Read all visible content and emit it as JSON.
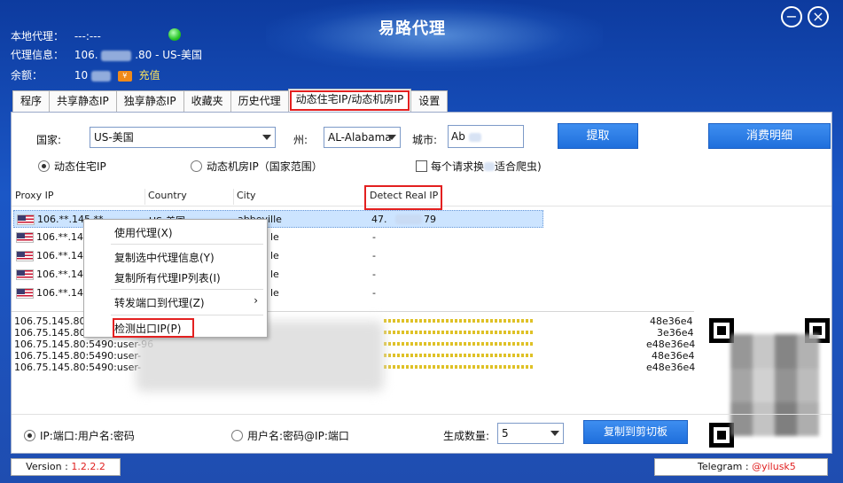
{
  "app": {
    "title": "易路代理",
    "minimize_glyph": "−",
    "close_glyph": "×"
  },
  "info": {
    "local_proxy_label": "本地代理：",
    "local_proxy_value": "---:---",
    "proxy_info_label": "代理信息：",
    "proxy_info_prefix": "106.",
    "proxy_info_suffix": ".80 - US-美国",
    "balance_label": "余额：",
    "balance_prefix": "10",
    "balance_badge": "¥",
    "recharge_label": "充值",
    "status_color": "#28c528"
  },
  "tabs": [
    {
      "label": "程序"
    },
    {
      "label": "共享静态IP"
    },
    {
      "label": "独享静态IP"
    },
    {
      "label": "收藏夹"
    },
    {
      "label": "历史代理"
    },
    {
      "label": "动态住宅IP/动态机房IP",
      "active": true
    },
    {
      "label": "设置"
    }
  ],
  "form": {
    "country_label": "国家:",
    "country_value": "US-美国",
    "state_label": "州:",
    "state_value": "AL-Alabama",
    "city_label": "城市:",
    "city_value": "Ab",
    "fetch_button": "提取",
    "billing_button": "消费明细",
    "radio_residential": "动态住宅IP",
    "radio_datacenter": "动态机房IP（国家范围）",
    "checkbox_per_request": "每个请求换",
    "checkbox_suffix": "适合爬虫)"
  },
  "table": {
    "headers": [
      "Proxy IP",
      "Country",
      "City",
      "Detect Real IP"
    ],
    "rows": [
      {
        "ip": "106.**.145.**",
        "country": "US-美国",
        "city": "abbeville",
        "real_ip": "47.",
        "real_ip_tail": "79"
      },
      {
        "ip": "106.**.145.",
        "country": "",
        "city": "le",
        "real_ip": "-",
        "real_ip_tail": ""
      },
      {
        "ip": "106.**.145.",
        "country": "",
        "city": "le",
        "real_ip": "-",
        "real_ip_tail": ""
      },
      {
        "ip": "106.**.145.",
        "country": "",
        "city": "le",
        "real_ip": "-",
        "real_ip_tail": ""
      },
      {
        "ip": "106.**.145.",
        "country": "",
        "city": "le",
        "real_ip": "-",
        "real_ip_tail": ""
      }
    ]
  },
  "context_menu": {
    "items": [
      "使用代理(X)",
      "复制选中代理信息(Y)",
      "复制所有代理IP列表(I)",
      "转发端口到代理(Z)",
      "检测出口IP(P)"
    ],
    "submenu_glyph": "›"
  },
  "output": {
    "lines": [
      "106.75.145.80:5",
      "106.75.145.80:5",
      "106.75.145.80:5490:user-96",
      "106.75.145.80:5490:user-",
      "106.75.145.80:5490:user-"
    ],
    "right_tails": [
      "48e36e4",
      "3e36e4",
      "e48e36e4",
      "48e36e4",
      "e48e36e4"
    ]
  },
  "bottom": {
    "format_a": "IP:端口:用户名:密码",
    "format_b": "用户名:密码@IP:端口",
    "count_label": "生成数量:",
    "count_value": "5",
    "copy_button": "复制到剪切板"
  },
  "footer": {
    "version_label": "Version : ",
    "version_value": "1.2.2.2",
    "telegram_label": "Telegram : ",
    "telegram_value": "@yilusk5"
  }
}
